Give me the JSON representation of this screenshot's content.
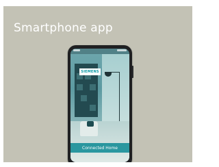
{
  "card": {
    "title": "Smartphone app",
    "background_color": "#c3c2b5"
  },
  "phone": {
    "brand_logo": "SIEMENS",
    "brand_color": "#0b9aa6",
    "cta_label": "Connected Home",
    "cta_color": "#128c96"
  }
}
